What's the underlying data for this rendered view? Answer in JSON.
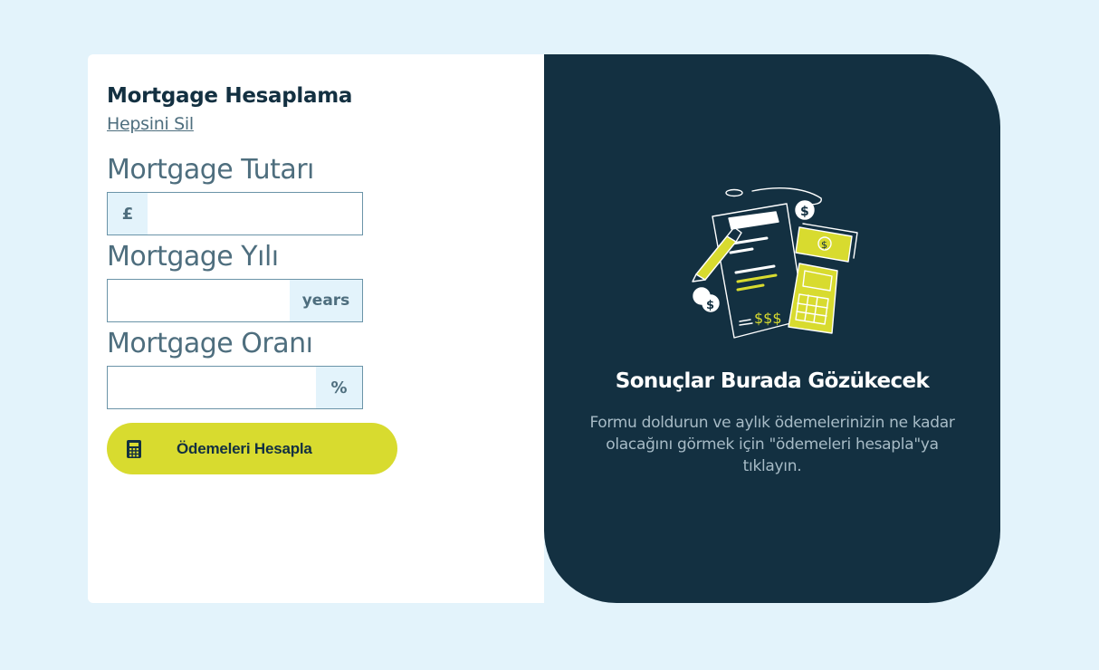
{
  "form": {
    "title": "Mortgage Hesaplama",
    "clear_all": "Hepsini Sil",
    "amount": {
      "label": "Mortgage Tutarı",
      "prefix": "£",
      "value": "",
      "placeholder": ""
    },
    "term": {
      "label": "Mortgage Yılı",
      "suffix": "years",
      "value": "",
      "placeholder": ""
    },
    "rate": {
      "label": "Mortgage Oranı",
      "suffix": "%",
      "value": "",
      "placeholder": ""
    },
    "submit": {
      "label": "Ödemeleri Hesapla",
      "icon": "calculator-icon"
    }
  },
  "results": {
    "illustration": "empty-results-illustration",
    "title": "Sonuçlar Burada Gözükecek",
    "description": "Formu doldurun ve aylık ödemelerinizin ne kadar olacağını görmek için \"ödemeleri hesapla\"ya tıklayın."
  },
  "colors": {
    "background": "#e3f3fb",
    "panel_dark": "#133041",
    "accent_lime": "#d8db2f",
    "text_muted": "#4e6e7e",
    "border": "#6b94a8"
  }
}
